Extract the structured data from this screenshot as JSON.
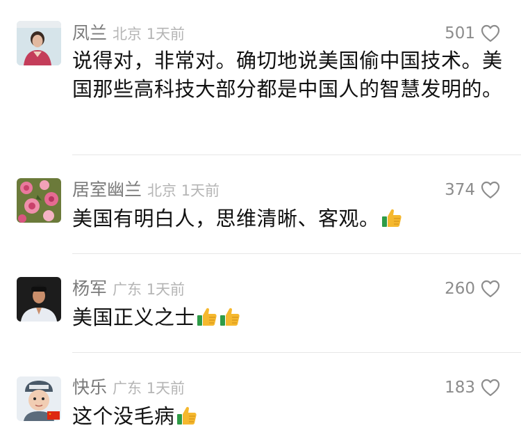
{
  "comments": [
    {
      "username": "凤兰",
      "location": "北京 1天前",
      "likes": "501",
      "text": "说得对，非常对。确切地说美国偷中国技术。美国那些高科技大部分都是中国人的智慧发明的。",
      "emojis": [],
      "avatar_icon": "elderly-woman-portrait"
    },
    {
      "username": "居室幽兰",
      "location": "北京 1天前",
      "likes": "374",
      "text": "美国有明白人，思维清晰、客观。",
      "emojis": [
        "thumbs-up-icon"
      ],
      "avatar_icon": "pink-flowers-painting"
    },
    {
      "username": "杨军",
      "location": "广东 1天前",
      "likes": "260",
      "text": "美国正义之士",
      "emojis": [
        "thumbs-up-icon",
        "thumbs-up-icon"
      ],
      "avatar_icon": "man-portrait"
    },
    {
      "username": "快乐",
      "location": "广东 1天前",
      "likes": "183",
      "text": "这个没毛病",
      "emojis": [
        "thumbs-up-icon"
      ],
      "avatar_icon": "child-with-flag-portrait"
    }
  ],
  "colors": {
    "username": "#7a7a7a",
    "location": "#b5b5b5",
    "like_count": "#8c8c8c",
    "text": "#111111",
    "divider": "#e6e6e6"
  }
}
